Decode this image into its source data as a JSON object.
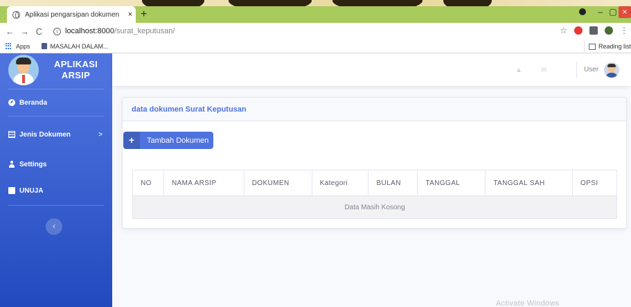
{
  "browser": {
    "tab_title": "Aplikasi pengarsipan dokumen",
    "tab_close": "×",
    "new_tab": "+",
    "url_host": "localhost:8000",
    "url_path": "/surat_keputusan/",
    "bookmarks": [
      {
        "label": "Apps",
        "icon": "apps-grid-icon"
      },
      {
        "label": "MASALAH DALAM...",
        "icon": "bookmark-folder-icon"
      }
    ],
    "reading_list": "Reading list",
    "window_controls": [
      "–",
      "▢",
      "×"
    ],
    "colors": {
      "tab_strip": "#a8cb5c",
      "close_button": "#e24b3c"
    }
  },
  "sidebar": {
    "brand_line1": "APLIKASI",
    "brand_line2": "ARSIP",
    "items": [
      {
        "label": "Beranda",
        "icon": "gauge-icon"
      },
      {
        "label": "Jenis Dokumen",
        "icon": "table-icon",
        "chevron": ">"
      },
      {
        "label": "Settings",
        "icon": "user-icon"
      },
      {
        "label": "UNUJA",
        "icon": "folder-icon"
      }
    ],
    "toggle": "‹",
    "colors": {
      "gradient_top": "#4e73df",
      "gradient_bottom": "#224abe"
    }
  },
  "topbar": {
    "user_label": "User",
    "icons": [
      "bell-icon",
      "envelope-icon"
    ]
  },
  "main": {
    "card_title": "data dokumen Surat Keputusan",
    "add_button": "Tambah Dokumen",
    "table": {
      "columns": [
        "NO",
        "NAMA ARSIP",
        "DOKUMEN",
        "Kategori",
        "BULAN",
        "TANGGAL",
        "TANGGAL SAH",
        "OPSI"
      ],
      "empty_message": "Data Masih Kosong"
    },
    "colors": {
      "primary": "#4e73df",
      "text": "#5a5c69"
    }
  },
  "os_overlay": {
    "watermark": "Activate Windows"
  }
}
